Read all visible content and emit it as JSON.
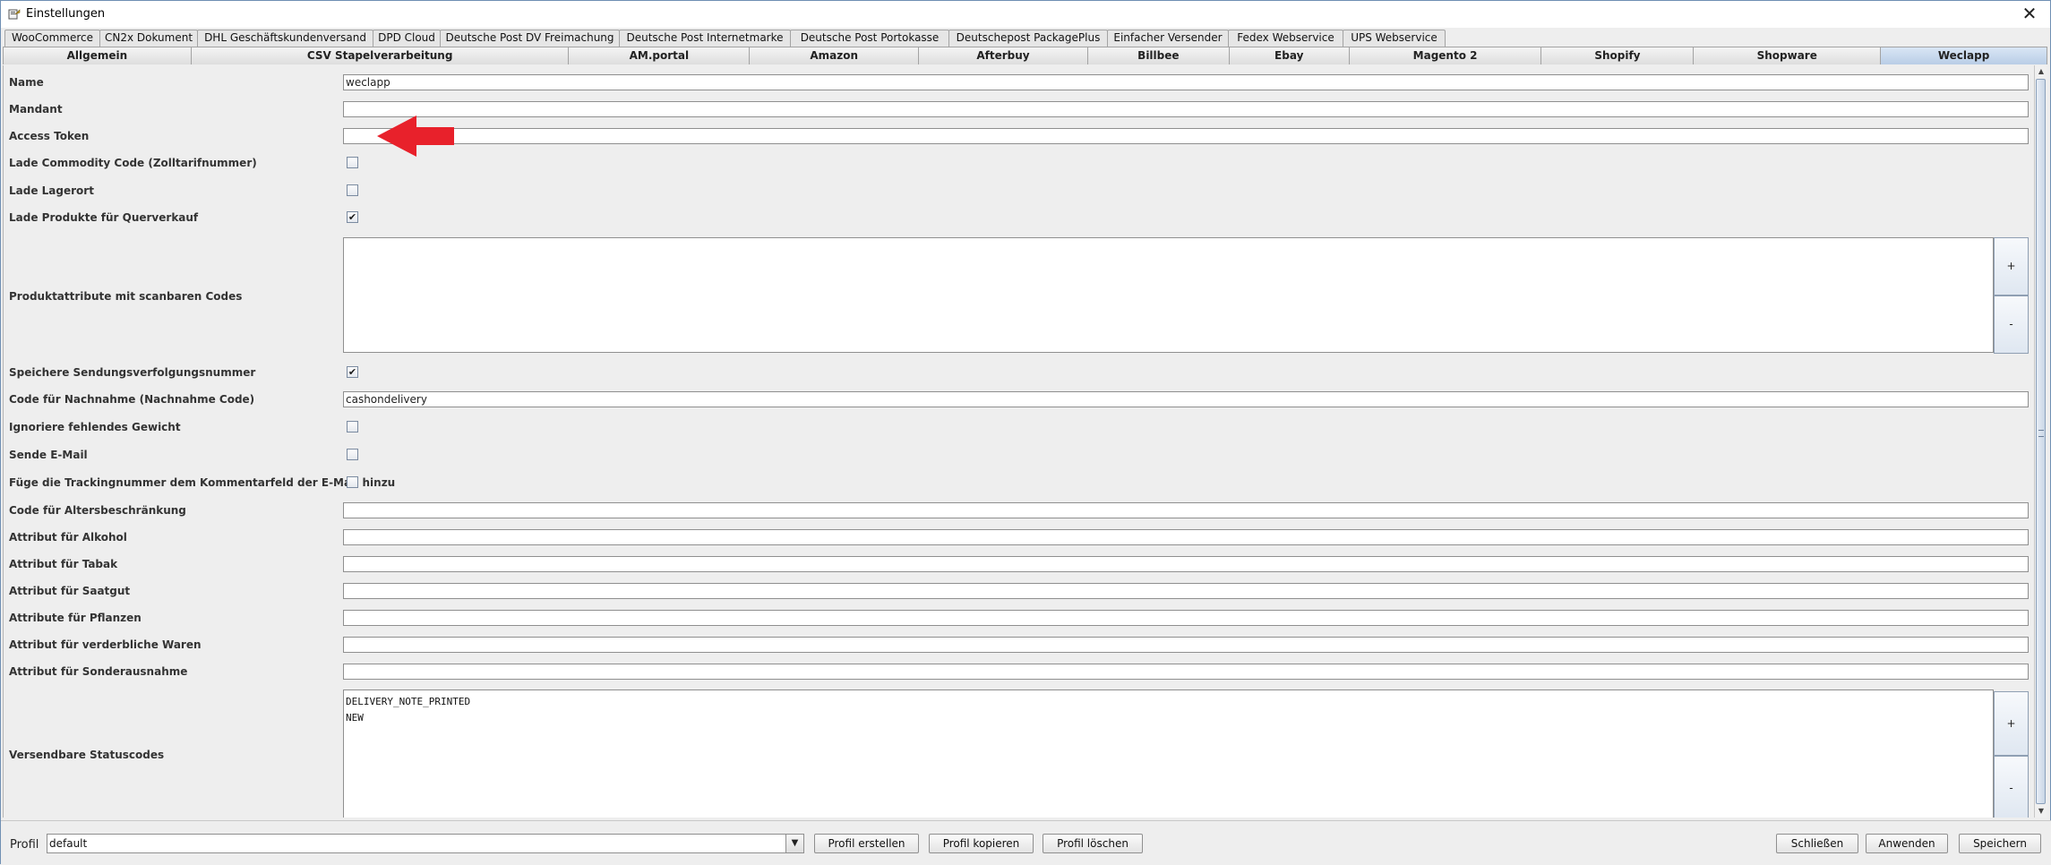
{
  "window": {
    "title": "Einstellungen",
    "close_glyph": "✕"
  },
  "tabs_row1": [
    "WooCommerce",
    "CN2x Dokument",
    "DHL Geschäftskundenversand",
    "DPD Cloud",
    "Deutsche Post DV Freimachung",
    "Deutsche Post Internetmarke",
    "Deutsche Post Portokasse",
    "Deutschepost PackagePlus",
    "Einfacher Versender",
    "Fedex Webservice",
    "UPS Webservice"
  ],
  "tabs_row2": [
    "Allgemein",
    "CSV Stapelverarbeitung",
    "AM.portal",
    "Amazon",
    "Afterbuy",
    "Billbee",
    "Ebay",
    "Magento 2",
    "Shopify",
    "Shopware",
    "Weclapp"
  ],
  "active_tab": "Weclapp",
  "form": {
    "name": {
      "label": "Name",
      "value": "weclapp"
    },
    "mandant": {
      "label": "Mandant",
      "value": ""
    },
    "access_token": {
      "label": "Access Token",
      "value": ""
    },
    "lade_commodity": {
      "label": "Lade Commodity Code (Zolltarifnummer)",
      "checked": false
    },
    "lade_lagerort": {
      "label": "Lade Lagerort",
      "checked": false
    },
    "lade_produkte": {
      "label": "Lade Produkte für Querverkauf",
      "checked": true
    },
    "produktattribute": {
      "label": "Produktattribute mit scanbaren Codes",
      "value": "",
      "add_label": "+",
      "remove_label": "-"
    },
    "speichere_sendung": {
      "label": "Speichere Sendungsverfolgungsnummer",
      "checked": true
    },
    "nachnahme_code": {
      "label": "Code für Nachnahme (Nachnahme Code)",
      "value": "cashondelivery"
    },
    "ignoriere_gewicht": {
      "label": "Ignoriere fehlendes Gewicht",
      "checked": false
    },
    "sende_email": {
      "label": "Sende E-Mail",
      "checked": false
    },
    "fuege_tracking": {
      "label": "Füge die Trackingnummer dem Kommentarfeld der E-Mail hinzu",
      "checked": false
    },
    "altersbeschraenkung": {
      "label": "Code für Altersbeschränkung",
      "value": ""
    },
    "alkohol": {
      "label": "Attribut für Alkohol",
      "value": ""
    },
    "tabak": {
      "label": "Attribut für Tabak",
      "value": ""
    },
    "saatgut": {
      "label": "Attribut für Saatgut",
      "value": ""
    },
    "pflanzen": {
      "label": "Attribute für Pflanzen",
      "value": ""
    },
    "verderbliche": {
      "label": "Attribut für verderbliche Waren",
      "value": ""
    },
    "sonderausnahme": {
      "label": "Attribut für Sonderausnahme",
      "value": ""
    },
    "statuscodes": {
      "label": "Versendbare Statuscodes",
      "value": "DELIVERY_NOTE_PRINTED\nNEW",
      "add_label": "+",
      "remove_label": "-"
    }
  },
  "checkmark": "✔",
  "bottom": {
    "profil_label": "Profil",
    "profil_value": "default",
    "dropdown_glyph": "▼",
    "buttons": {
      "erstellen": "Profil erstellen",
      "kopieren": "Profil kopieren",
      "loeschen": "Profil löschen",
      "schliessen": "Schließen",
      "anwenden": "Anwenden",
      "speichern": "Speichern"
    }
  },
  "scrollbar": {
    "up": "▲",
    "down": "▼"
  },
  "colors": {
    "active_tab": "#c3d4ea",
    "annotation_arrow": "#e8212b"
  }
}
